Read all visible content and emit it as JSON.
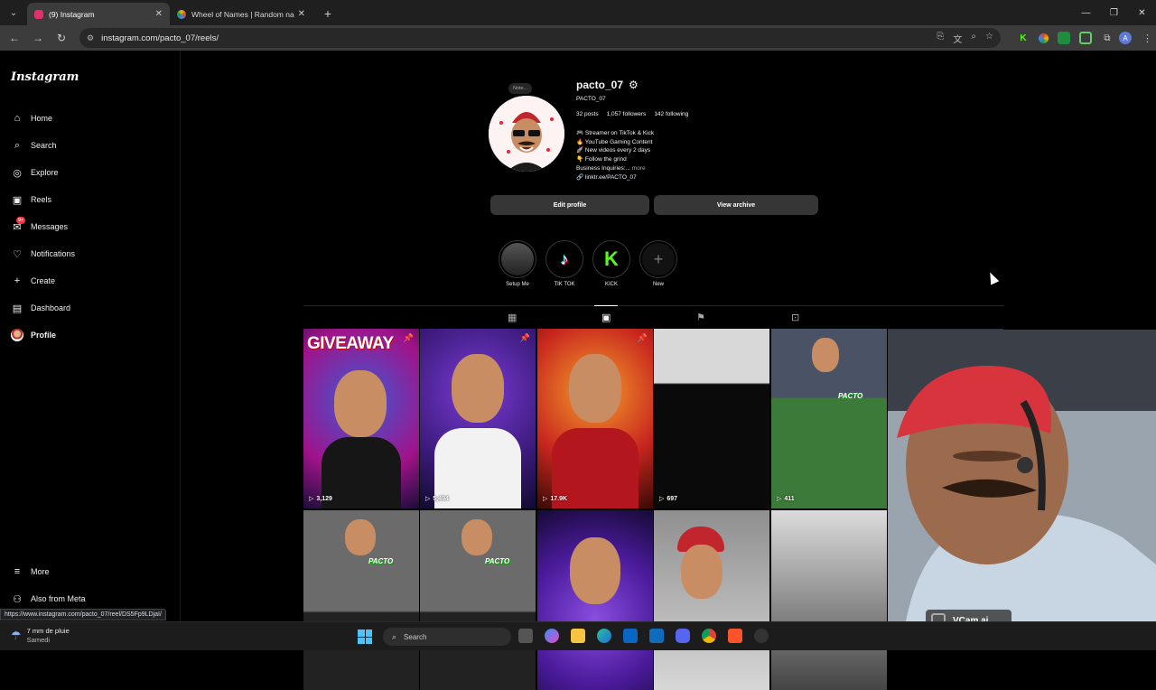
{
  "browser": {
    "tabs": [
      {
        "title": "(9) Instagram",
        "active": true,
        "favicon_color": "#e1306c"
      },
      {
        "title": "Wheel of Names | Random nam",
        "active": false,
        "favicon_color": "#f4b400"
      }
    ],
    "url": "instagram.com/pacto_07/reels/",
    "status_url": "https://www.instagram.com/pacto_07/reel/DS5Fp9LDjaI/"
  },
  "instagram": {
    "logo": "Instagram",
    "nav": [
      {
        "label": "Home",
        "icon": "home-icon"
      },
      {
        "label": "Search",
        "icon": "search-icon"
      },
      {
        "label": "Explore",
        "icon": "compass-icon"
      },
      {
        "label": "Reels",
        "icon": "reels-icon"
      },
      {
        "label": "Messages",
        "icon": "messenger-icon",
        "badge": "9+"
      },
      {
        "label": "Notifications",
        "icon": "heart-icon"
      },
      {
        "label": "Create",
        "icon": "plus-icon"
      },
      {
        "label": "Dashboard",
        "icon": "dashboard-icon"
      },
      {
        "label": "Profile",
        "icon": "avatar"
      }
    ],
    "nav_bottom": [
      {
        "label": "More",
        "icon": "menu-icon"
      },
      {
        "label": "Also from Meta",
        "icon": "meta-icon"
      }
    ],
    "profile": {
      "note": "Note...",
      "username": "pacto_07",
      "full_name": "PACTO_07",
      "posts": "32 posts",
      "followers": "1,057 followers",
      "following": "142 following",
      "bio": [
        "🎮 Streamer on TikTok & Kick",
        "🔥 YouTube Gaming Content",
        "🚀 New videos every 2 days",
        "👇 Follow the grind",
        "Business Inquiries:..."
      ],
      "bio_more": "more",
      "link": "linktr.ee/PACTO_07",
      "edit_profile": "Edit profile",
      "view_archive": "View archive"
    },
    "highlights": [
      {
        "label": "Setup Me"
      },
      {
        "label": "TIK TOK"
      },
      {
        "label": "KICK"
      },
      {
        "label": "New"
      }
    ],
    "reels": [
      {
        "views": "3,129",
        "pinned": true,
        "title": "GIVEAWAY"
      },
      {
        "views": "5,494",
        "pinned": true
      },
      {
        "views": "17.9K",
        "pinned": true
      },
      {
        "views": "697",
        "pinned": false
      },
      {
        "views": "411",
        "pinned": false
      },
      {
        "views": "",
        "pinned": false
      },
      {
        "views": "",
        "pinned": false,
        "tag": "PACTO"
      },
      {
        "views": "",
        "pinned": false,
        "tag": "PACTO"
      },
      {
        "views": "",
        "pinned": false
      },
      {
        "views": "",
        "pinned": false
      },
      {
        "views": "",
        "pinned": false
      }
    ]
  },
  "overlay": {
    "vcam": "VCam.ai"
  },
  "taskbar": {
    "weather_main": "7 mm de pluie",
    "weather_sub": "Samedi",
    "search": "Search"
  }
}
